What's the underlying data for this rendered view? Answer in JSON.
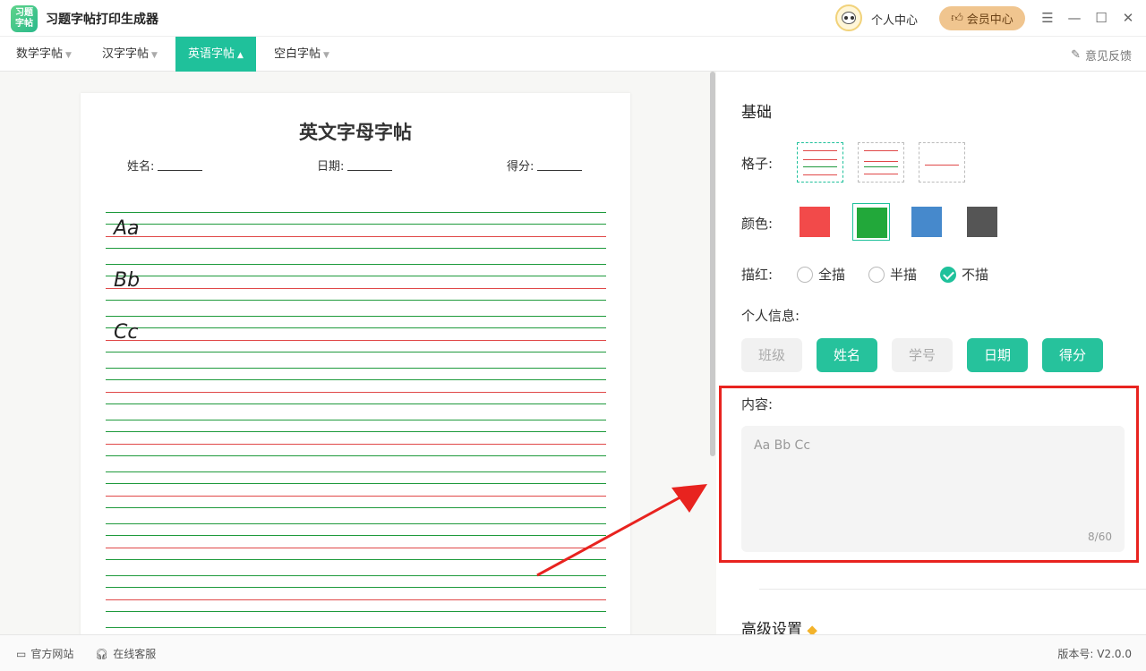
{
  "app": {
    "title": "习题字帖打印生成器",
    "logo_text_top": "习题",
    "logo_text_bottom": "字帖"
  },
  "header": {
    "user_center": "个人中心",
    "vip_label": "会员中心",
    "icons": [
      "menu-icon",
      "minimize-icon",
      "maximize-icon",
      "close-icon"
    ]
  },
  "tabs": [
    {
      "label": "数学字帖",
      "active": false
    },
    {
      "label": "汉字字帖",
      "active": false
    },
    {
      "label": "英语字帖",
      "active": true
    },
    {
      "label": "空白字帖",
      "active": false
    }
  ],
  "feedback_label": "意见反馈",
  "paper": {
    "title": "英文字母字帖",
    "fields": [
      {
        "label": "姓名:"
      },
      {
        "label": "日期:"
      },
      {
        "label": "得分:"
      }
    ],
    "letters": [
      "Aa",
      "Bb",
      "Cc"
    ]
  },
  "panel": {
    "basic_title": "基础",
    "grid_label": "格子:",
    "color_label": "颜色:",
    "colors": [
      "#f24a4a",
      "#22a83a",
      "#4689cc",
      "#555555"
    ],
    "selected_color": 1,
    "trace_label": "描红:",
    "trace_options": [
      {
        "label": "全描",
        "checked": false
      },
      {
        "label": "半描",
        "checked": false
      },
      {
        "label": "不描",
        "checked": true
      }
    ],
    "info_label": "个人信息:",
    "info_chips": [
      {
        "label": "班级",
        "on": false
      },
      {
        "label": "姓名",
        "on": true
      },
      {
        "label": "学号",
        "on": false
      },
      {
        "label": "日期",
        "on": true
      },
      {
        "label": "得分",
        "on": true
      }
    ],
    "content_label": "内容:",
    "content_value": "Aa Bb Cc",
    "content_counter": "8/60",
    "advanced_title": "高级设置"
  },
  "statusbar": {
    "website": "官方网站",
    "support": "在线客服",
    "version": "版本号: V2.0.0"
  }
}
